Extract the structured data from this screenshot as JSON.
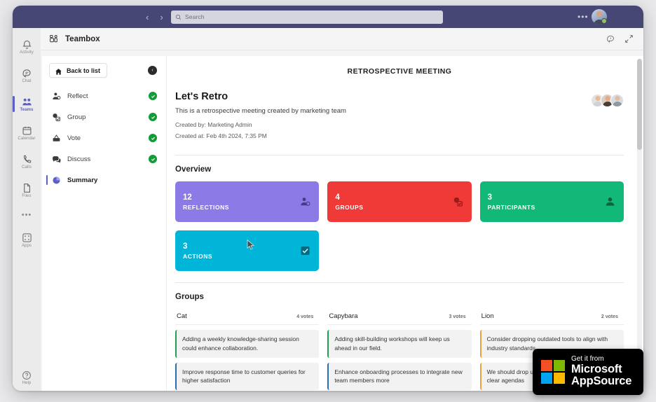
{
  "window": {
    "title_bar": {
      "back_arrow": "‹",
      "forward_arrow": "›",
      "search_placeholder": "Search",
      "search_value": "",
      "more_label": "•••"
    }
  },
  "rail": {
    "items": [
      {
        "label": "Activity",
        "icon": "bell-icon",
        "active": false
      },
      {
        "label": "Chat",
        "icon": "chat-icon",
        "active": false
      },
      {
        "label": "Teams",
        "icon": "teams-icon",
        "active": true
      },
      {
        "label": "Calendar",
        "icon": "calendar-icon",
        "active": false
      },
      {
        "label": "Calls",
        "icon": "phone-icon",
        "active": false
      },
      {
        "label": "Files",
        "icon": "file-icon",
        "active": false
      }
    ],
    "more_label": "•••",
    "apps": {
      "label": "Apps",
      "icon": "apps-icon"
    },
    "help": {
      "label": "Help",
      "icon": "help-icon"
    }
  },
  "app_header": {
    "title": "Teambox",
    "icon": "teambox-grid-icon",
    "actions": [
      {
        "name": "feedback-icon"
      },
      {
        "name": "collapse-expand-icon"
      }
    ]
  },
  "steps_panel": {
    "back_label": "Back to list",
    "collapse_label": "‹",
    "steps": [
      {
        "label": "Reflect",
        "icon": "reflect-person-icon",
        "done": true,
        "current": false
      },
      {
        "label": "Group",
        "icon": "group-check-icon",
        "done": true,
        "current": false
      },
      {
        "label": "Vote",
        "icon": "vote-ballot-icon",
        "done": true,
        "current": false
      },
      {
        "label": "Discuss",
        "icon": "discuss-chat-icon",
        "done": true,
        "current": false
      },
      {
        "label": "Summary",
        "icon": "summary-pie-icon",
        "done": false,
        "current": true
      }
    ]
  },
  "retro": {
    "kicker": "RETROSPECTIVE MEETING",
    "title": "Let's Retro",
    "description": "This is a retrospective meeting created by marketing team",
    "created_by": "Created by: Marketing Admin",
    "created_at": "Created at: Feb 4th 2024, 7:35 PM",
    "participant_avatars": [
      {
        "name": "participant-avatar-1",
        "bg": "#e7e2de",
        "head": "#e8b99a",
        "body": "#cfd3d8"
      },
      {
        "name": "participant-avatar-2",
        "bg": "#d9cfc2",
        "head": "#e3a887",
        "body": "#4a3d33"
      },
      {
        "name": "participant-avatar-3",
        "bg": "#d7dde2",
        "head": "#e5bb9c",
        "body": "#8d9aa6"
      }
    ]
  },
  "overview": {
    "title": "Overview",
    "cards": [
      {
        "value": "12",
        "label": "REFLECTIONS",
        "color": "#8c7ae6",
        "icon": "person-reflection-icon"
      },
      {
        "value": "4",
        "label": "GROUPS",
        "color": "#f03a37",
        "icon": "group-stack-icon"
      },
      {
        "value": "3",
        "label": "PARTICIPANTS",
        "color": "#11b877",
        "icon": "person-icon"
      },
      {
        "value": "3",
        "label": "ACTIONS",
        "color": "#00b5d8",
        "icon": "checkbox-icon"
      }
    ]
  },
  "groups": {
    "title": "Groups",
    "vote_suffix": "votes",
    "columns": [
      {
        "name": "Cat",
        "votes": "4 votes",
        "items": [
          {
            "text": "Adding a weekly knowledge-sharing session could enhance collaboration.",
            "accent": "#1f9d55"
          },
          {
            "text": "Improve response time to customer queries for higher satisfaction",
            "accent": "#2b6cb0"
          }
        ]
      },
      {
        "name": "Capybara",
        "votes": "3 votes",
        "items": [
          {
            "text": "Adding skill-building workshops will keep us ahead in our field.",
            "accent": "#1f9d55"
          },
          {
            "text": "Enhance onboarding processes to integrate new team members more",
            "accent": "#2b6cb0"
          }
        ]
      },
      {
        "name": "Lion",
        "votes": "2 votes",
        "items": [
          {
            "text": "Consider dropping outdated tools to align with industry standards",
            "accent": "#e8a33d"
          },
          {
            "text": "We should drop unnecessary meetings without clear agendas",
            "accent": "#e8a33d"
          }
        ]
      }
    ]
  },
  "appsource_badge": {
    "line1": "Get it from",
    "line2": "Microsoft",
    "line3": "AppSource",
    "colors": [
      "#f25022",
      "#7fba00",
      "#00a4ef",
      "#ffb900"
    ]
  }
}
